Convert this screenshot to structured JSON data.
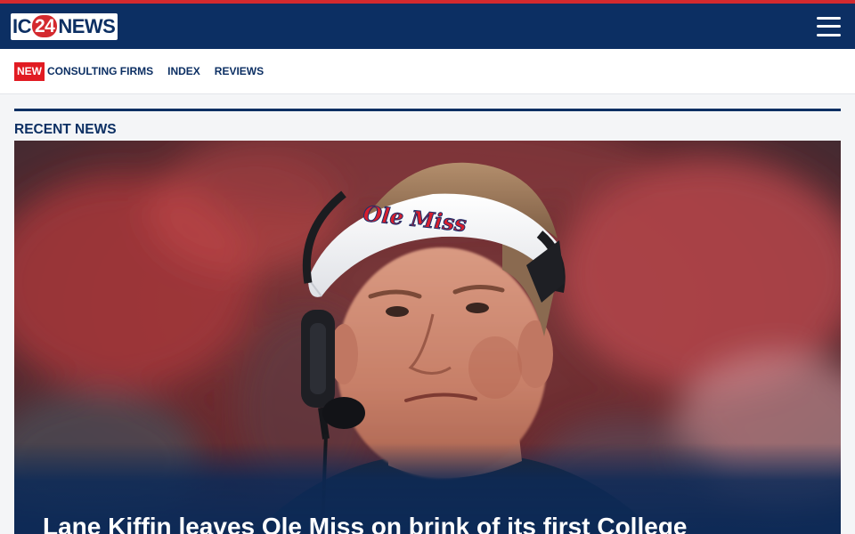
{
  "site": {
    "logo": {
      "part1": "IC",
      "part2": "24",
      "part3": "NEWS"
    },
    "menu_icon": "hamburger-menu-icon"
  },
  "colors": {
    "brand_navy": "#0c2f63",
    "accent_red": "#d42a2f",
    "badge_red": "#e11b22"
  },
  "subnav": {
    "badge": "NEW",
    "items": [
      "CONSULTING FIRMS",
      "INDEX",
      "REVIEWS"
    ]
  },
  "section": {
    "title": "RECENT NEWS"
  },
  "featured": {
    "headline": "Lane Kiffin leaves Ole Miss on brink of its first College",
    "image": {
      "visor_text": "Ole Miss"
    }
  }
}
